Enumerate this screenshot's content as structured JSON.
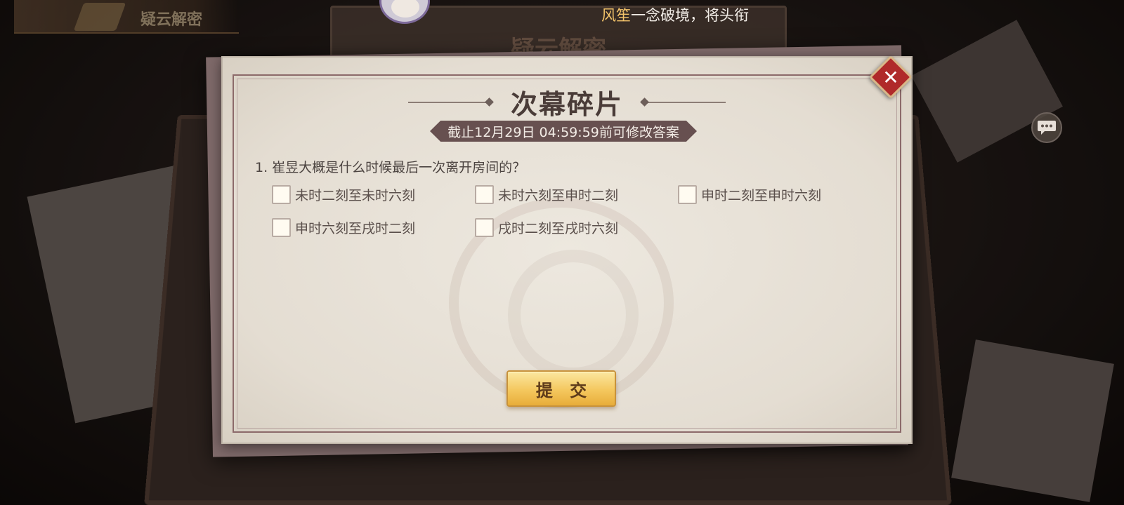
{
  "background": {
    "top_left_title": "疑云解密",
    "header_banner": "疑云解密"
  },
  "notice": {
    "name": "风笙",
    "text": "一念破境，将头衔"
  },
  "dialog": {
    "title": "次幕碎片",
    "deadline": "截止12月29日 04:59:59前可修改答案",
    "question": "1. 崔昱大概是什么时候最后一次离开房间的？",
    "options": [
      "未时二刻至未时六刻",
      "未时六刻至申时二刻",
      "申时二刻至申时六刻",
      "申时六刻至戌时二刻",
      "戌时二刻至戌时六刻"
    ],
    "submit_label": "提 交",
    "close_label": "✕"
  },
  "icons": {
    "close": "close-icon",
    "chat": "chat-bubble-icon"
  },
  "colors": {
    "accent_gold": "#f4c75e",
    "close_red": "#b02a2a",
    "notice_name": "#f2c36a",
    "tag_bg": "#675050"
  }
}
